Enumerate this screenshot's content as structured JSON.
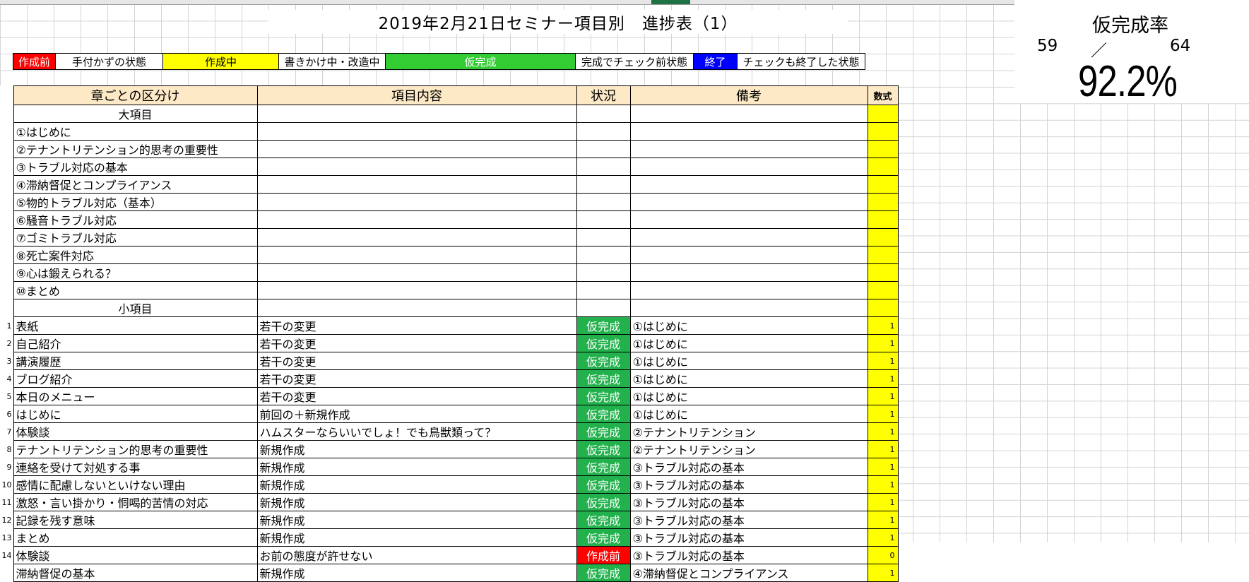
{
  "title": "2019年2月21日セミナー項目別　進捗表（1）",
  "legend": [
    {
      "label": "作成前",
      "bg": "#ff0000",
      "fg": "#ffffff"
    },
    {
      "label": "手付かずの状態",
      "bg": "#ffffff",
      "fg": "#000000"
    },
    {
      "label": "作成中",
      "bg": "#ffff00",
      "fg": "#000000"
    },
    {
      "label": "書きかけ中・改造中",
      "bg": "#ffffff",
      "fg": "#000000"
    },
    {
      "label": "仮完成",
      "bg": "#33cc33",
      "fg": "#ffffff"
    },
    {
      "label": "完成でチェック前状態",
      "bg": "#ffffff",
      "fg": "#000000"
    },
    {
      "label": "終了",
      "bg": "#0000ff",
      "fg": "#ffffff"
    },
    {
      "label": "チェックも終了した状態",
      "bg": "#ffffff",
      "fg": "#000000"
    }
  ],
  "progress": {
    "title": "仮完成率",
    "done": "59",
    "slash": "／",
    "total": "64",
    "rate": "92.2%",
    "rate_value": 0.922
  },
  "table": {
    "headers": {
      "chapter": "章ごとの区分け",
      "content": "項目内容",
      "status": "状況",
      "notes": "備考",
      "formula": "数式"
    },
    "major_label": "大項目",
    "major_items": [
      "①はじめに",
      "②テナントリテンション的思考の重要性",
      "③トラブル対応の基本",
      "④滞納督促とコンプライアンス",
      "⑤物的トラブル対応（基本）",
      "⑥騒音トラブル対応",
      "⑦ゴミトラブル対応",
      "⑧死亡案件対応",
      "⑨心は鍛えられる？",
      "⑩まとめ"
    ],
    "minor_label": "小項目",
    "minor_items": [
      {
        "no": "1",
        "chapter": "表紙",
        "content": "若干の変更",
        "status": "仮完成",
        "notes": "①はじめに",
        "formula": "1"
      },
      {
        "no": "2",
        "chapter": "自己紹介",
        "content": "若干の変更",
        "status": "仮完成",
        "notes": "①はじめに",
        "formula": "1"
      },
      {
        "no": "3",
        "chapter": "講演履歴",
        "content": "若干の変更",
        "status": "仮完成",
        "notes": "①はじめに",
        "formula": "1"
      },
      {
        "no": "4",
        "chapter": "ブログ紹介",
        "content": "若干の変更",
        "status": "仮完成",
        "notes": "①はじめに",
        "formula": "1"
      },
      {
        "no": "5",
        "chapter": "本日のメニュー",
        "content": "若干の変更",
        "status": "仮完成",
        "notes": "①はじめに",
        "formula": "1"
      },
      {
        "no": "6",
        "chapter": "はじめに",
        "content": "前回の＋新規作成",
        "status": "仮完成",
        "notes": "①はじめに",
        "formula": "1"
      },
      {
        "no": "7",
        "chapter": "体験談",
        "content": "ハムスターならいいでしょ！でも鳥獣類って？",
        "status": "仮完成",
        "notes": "②テナントリテンション",
        "formula": "1"
      },
      {
        "no": "8",
        "chapter": "テナントリテンション的思考の重要性",
        "content": "新規作成",
        "status": "仮完成",
        "notes": "②テナントリテンション",
        "formula": "1"
      },
      {
        "no": "9",
        "chapter": "連絡を受けて対処する事",
        "content": "新規作成",
        "status": "仮完成",
        "notes": "③トラブル対応の基本",
        "formula": "1"
      },
      {
        "no": "10",
        "chapter": "感情に配慮しないといけない理由",
        "content": "新規作成",
        "status": "仮完成",
        "notes": "③トラブル対応の基本",
        "formula": "1"
      },
      {
        "no": "11",
        "chapter": "激怒・言い掛かり・恫喝的苦情の対応",
        "content": "新規作成",
        "status": "仮完成",
        "notes": "③トラブル対応の基本",
        "formula": "1"
      },
      {
        "no": "12",
        "chapter": "記録を残す意味",
        "content": "新規作成",
        "status": "仮完成",
        "notes": "③トラブル対応の基本",
        "formula": "1"
      },
      {
        "no": "13",
        "chapter": "まとめ",
        "content": "新規作成",
        "status": "仮完成",
        "notes": "③トラブル対応の基本",
        "formula": "1"
      },
      {
        "no": "14",
        "chapter": "体験談",
        "content": "お前の態度が許せない",
        "status": "作成前",
        "notes": "③トラブル対応の基本",
        "formula": "0"
      },
      {
        "no": "",
        "chapter": "滞納督促の基本",
        "content": "新規作成",
        "status": "仮完成",
        "notes": "④滞納督促とコンプライアンス",
        "formula": "1"
      }
    ]
  },
  "status_colors": {
    "仮完成": "#22b14c",
    "作成前": "#ff0000",
    "作成中": "#ffff00",
    "終了": "#0000ff"
  }
}
